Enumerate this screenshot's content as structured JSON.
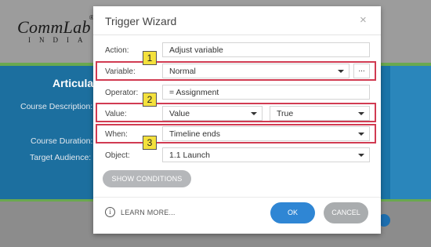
{
  "background": {
    "logo_text": "CommLab",
    "logo_sub": "INDIA",
    "logo_reg": "®",
    "slide_title": "Articulat",
    "course_description_label": "Course Description: T",
    "course_duration_label": "Course Duration: T",
    "target_audience_label": "Target Audience: T"
  },
  "dialog": {
    "title": "Trigger Wizard",
    "close_glyph": "×",
    "rows": {
      "action": {
        "label": "Action:",
        "value": "Adjust variable"
      },
      "variable": {
        "label": "Variable:",
        "value": "Normal",
        "more": "..."
      },
      "operator": {
        "label": "Operator:",
        "value": "= Assignment"
      },
      "value": {
        "label": "Value:",
        "value": "Value",
        "second_value": "True"
      },
      "when": {
        "label": "When:",
        "value": "Timeline ends"
      },
      "object": {
        "label": "Object:",
        "value": "1.1 Launch"
      }
    },
    "show_conditions": "SHOW CONDITIONS",
    "learn_more": "LEARN MORE...",
    "ok": "OK",
    "cancel": "CANCEL"
  },
  "callouts": [
    "1",
    "2",
    "3"
  ],
  "colors": {
    "highlight": "#d13b52",
    "callout": "#f4e13c",
    "ok_button": "#2f86d4",
    "slide_blue": "#1c6f9f"
  }
}
